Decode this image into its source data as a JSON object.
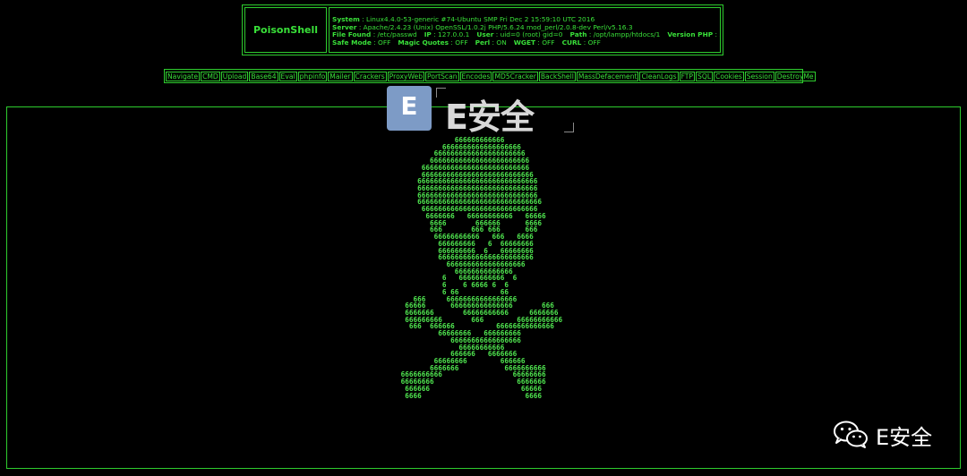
{
  "header": {
    "brand": "PoisonShell",
    "lines": [
      [
        {
          "k": "System",
          "v": " : Linux4.4.0-53-generic #74-Ubuntu SMP Fri Dec 2 15:59:10 UTC 2016"
        }
      ],
      [
        {
          "k": "Server",
          "v": " : Apache/2.4.23 (Unix) OpenSSL/1.0.2j PHP/5.6.24 mod_perl/2.0.8-dev Perl/v5.16.3"
        }
      ],
      [
        {
          "k": "File Found",
          "v": " : /etc/passwd"
        },
        {
          "k": "IP",
          "v": " : 127.0.0.1"
        },
        {
          "k": "User",
          "v": " : uid=0 (root) gid=0"
        },
        {
          "k": "Path",
          "v": " : /opt/lampp/htdocs/1"
        },
        {
          "k": "Version PHP",
          "v": " : 5.6.24"
        }
      ],
      [
        {
          "k": "Safe Mode",
          "v": " : OFF"
        },
        {
          "k": "Magic Quotes",
          "v": " : OFF"
        },
        {
          "k": "Perl",
          "v": " : ON"
        },
        {
          "k": "WGET",
          "v": " : OFF"
        },
        {
          "k": "CURL",
          "v": " : OFF"
        }
      ]
    ]
  },
  "nav": [
    "Navigate",
    "CMD",
    "Upload",
    "Base64",
    "Eval",
    "phpinfo",
    "Mailer",
    "Crackers",
    "ProxyWeb",
    "PortScan",
    "Encodes",
    "MD5Cracker",
    "BackShell",
    "MassDefacement",
    "CleanLogs",
    "FTP",
    "SQL",
    "Cookies",
    "Session",
    "DestroyMe"
  ],
  "skull": [
    "              666666666666",
    "           6666666666666666666",
    "         6666666666666666666666",
    "        666666666666666666666666",
    "      66666666666666666666666666",
    "      666666666666666666666666666",
    "     66666666666666666666666666666",
    "     66666666666666666666666666666",
    "     66666666666666666666666666666",
    "     666666666666666666666666666666",
    "      6666666666666666666666666666",
    "       6666666   66666666666   66666",
    "        6666       666666      6666",
    "        666       666 666      666",
    "         66666666666   666   6666",
    "          666666666   6  66666666",
    "          666666666  6   66666666",
    "          66666666666666666666666",
    "            6666666666666666666",
    "              66666666666666",
    "           6   66666666666  6",
    "           6    6 6666 6  6",
    "           6 66          66",
    "    666     66666666666666666",
    "  66666      666666666666666       666",
    "  6666666       66666666666     6666666",
    "  666666666       666        66666666666",
    "   666  666666          66666666666666",
    "          66666666   666666666",
    "             66666666666666666",
    "               66666666666",
    "             666666   6666666",
    "         66666666        666666",
    "        6666666           6666666666",
    " 6666666666                 66666666",
    " 66666666                    6666666",
    "  666666                      66666",
    "  6666                         6666"
  ],
  "watermark": {
    "logo_letter": "E",
    "logo_text": "E安全",
    "wechat_label": "E安全",
    "logo_color": "#7d9bc6"
  },
  "colors": {
    "background": "#000000",
    "accent": "#39e039",
    "border": "#2ecc2e"
  }
}
